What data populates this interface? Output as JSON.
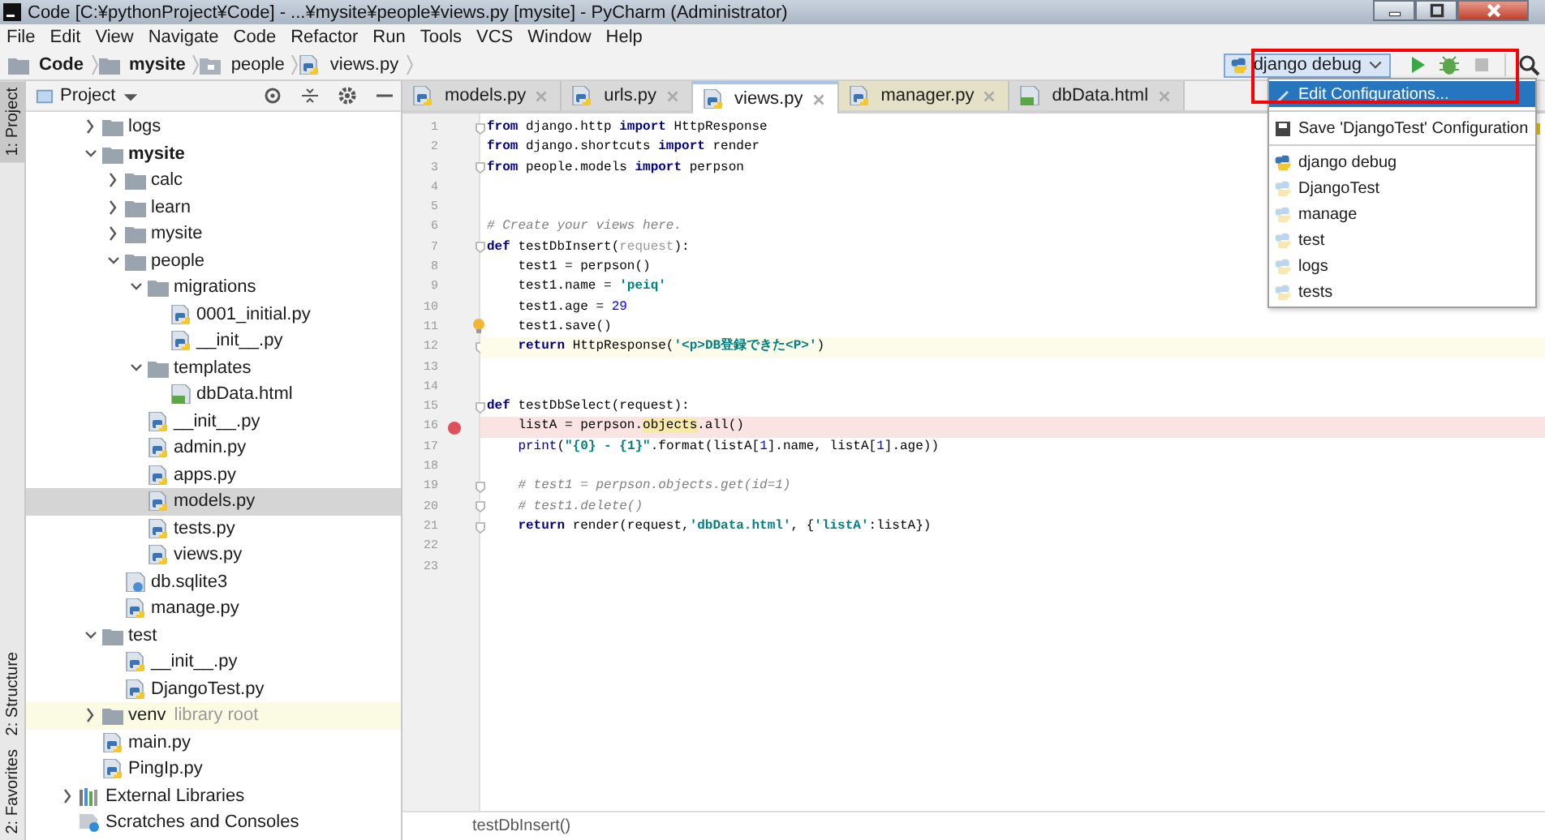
{
  "window": {
    "title": "Code [C:¥pythonProject¥Code] - ...¥mysite¥people¥views.py [mysite] - PyCharm (Administrator)"
  },
  "menu": [
    "File",
    "Edit",
    "View",
    "Navigate",
    "Code",
    "Refactor",
    "Run",
    "Tools",
    "VCS",
    "Window",
    "Help"
  ],
  "breadcrumbs": [
    {
      "label": "Code",
      "kind": "folder",
      "bold": true
    },
    {
      "label": "mysite",
      "kind": "folder",
      "bold": true
    },
    {
      "label": "people",
      "kind": "package",
      "bold": false
    },
    {
      "label": "views.py",
      "kind": "python",
      "bold": false
    }
  ],
  "run_config": {
    "label": "django debug"
  },
  "annotation_frame": true,
  "config_menu": {
    "items": [
      {
        "label": "Edit Configurations...",
        "kind": "edit",
        "selected": true,
        "temporary": false
      },
      {
        "label": "Save 'DjangoTest' Configuration",
        "kind": "save",
        "selected": false,
        "temporary": false
      },
      {
        "label": "django debug",
        "kind": "config",
        "selected": false,
        "temporary": false
      },
      {
        "label": "DjangoTest",
        "kind": "config",
        "selected": false,
        "temporary": true
      },
      {
        "label": "manage",
        "kind": "config",
        "selected": false,
        "temporary": true
      },
      {
        "label": "test",
        "kind": "config",
        "selected": false,
        "temporary": true
      },
      {
        "label": "logs",
        "kind": "config",
        "selected": false,
        "temporary": true
      },
      {
        "label": "tests",
        "kind": "config",
        "selected": false,
        "temporary": true
      }
    ]
  },
  "tool_stripe": [
    {
      "label": "1: Project",
      "selected": true
    },
    {
      "label": "2: Structure",
      "selected": false
    },
    {
      "label": "2: Favorites",
      "selected": false
    }
  ],
  "project_panel": {
    "title": "Project",
    "items": [
      {
        "label": "logs",
        "kind": "folder",
        "expanded": false,
        "selected": false,
        "bold": false
      },
      {
        "label": "mysite",
        "kind": "folder",
        "expanded": true,
        "selected": false,
        "bold": true,
        "children": [
          {
            "label": "calc",
            "kind": "folder",
            "expanded": false,
            "selected": false,
            "bold": false
          },
          {
            "label": "learn",
            "kind": "folder",
            "expanded": false,
            "selected": false,
            "bold": false
          },
          {
            "label": "mysite",
            "kind": "folder",
            "expanded": false,
            "selected": false,
            "bold": false
          },
          {
            "label": "people",
            "kind": "folder",
            "expanded": true,
            "selected": false,
            "bold": false,
            "children": [
              {
                "label": "migrations",
                "kind": "folder",
                "expanded": true,
                "selected": false,
                "bold": false,
                "children": [
                  {
                    "label": "0001_initial.py",
                    "kind": "python",
                    "selected": false,
                    "bold": false
                  },
                  {
                    "label": "__init__.py",
                    "kind": "python",
                    "selected": false,
                    "bold": false
                  }
                ]
              },
              {
                "label": "templates",
                "kind": "folder",
                "expanded": true,
                "selected": false,
                "bold": false,
                "children": [
                  {
                    "label": "dbData.html",
                    "kind": "html",
                    "selected": false,
                    "bold": false
                  }
                ]
              },
              {
                "label": "__init__.py",
                "kind": "python",
                "selected": false,
                "bold": false
              },
              {
                "label": "admin.py",
                "kind": "python",
                "selected": false,
                "bold": false
              },
              {
                "label": "apps.py",
                "kind": "python",
                "selected": false,
                "bold": false
              },
              {
                "label": "models.py",
                "kind": "python",
                "selected": true,
                "bold": false
              },
              {
                "label": "tests.py",
                "kind": "python",
                "selected": false,
                "bold": false
              },
              {
                "label": "views.py",
                "kind": "python",
                "selected": false,
                "bold": false
              }
            ]
          },
          {
            "label": "db.sqlite3",
            "kind": "database",
            "selected": false,
            "bold": false
          },
          {
            "label": "manage.py",
            "kind": "python",
            "selected": false,
            "bold": false
          }
        ]
      },
      {
        "label": "test",
        "kind": "folder",
        "expanded": true,
        "selected": false,
        "bold": false,
        "children": [
          {
            "label": "__init__.py",
            "kind": "python",
            "selected": false,
            "bold": false
          },
          {
            "label": "DjangoTest.py",
            "kind": "python",
            "selected": false,
            "bold": false
          }
        ]
      },
      {
        "label": "venv",
        "kind": "folder",
        "expanded": false,
        "selected": false,
        "bold": false,
        "note": "library root"
      },
      {
        "label": "main.py",
        "kind": "python",
        "selected": false,
        "bold": false
      },
      {
        "label": "PingIp.py",
        "kind": "python",
        "selected": false,
        "bold": false
      }
    ],
    "extra_items": [
      {
        "label": "External Libraries",
        "kind": "libraries",
        "expanded": false,
        "selected": false,
        "bold": false
      },
      {
        "label": "Scratches and Consoles",
        "kind": "scratches",
        "selected": false,
        "bold": false
      }
    ]
  },
  "editor_tabs": [
    {
      "label": "models.py",
      "kind": "python",
      "selected": false,
      "color": "#d9d9d9"
    },
    {
      "label": "urls.py",
      "kind": "python",
      "selected": false,
      "color": "#d9d9d9"
    },
    {
      "label": "views.py",
      "kind": "python",
      "selected": true,
      "color": "#ffffff"
    },
    {
      "label": "manager.py",
      "kind": "python",
      "selected": false,
      "color": "#e4e1c6"
    },
    {
      "label": "dbData.html",
      "kind": "html",
      "selected": false,
      "color": "#d9d9d9"
    }
  ],
  "code": {
    "lines": [
      {
        "number": "1",
        "caret": false,
        "breakpoint": false,
        "fold": true,
        "bulb": false,
        "segments": [
          {
            "text": "from",
            "kind": "keyword"
          },
          {
            "text": " django.http ",
            "kind": "plain"
          },
          {
            "text": "import",
            "kind": "keyword"
          },
          {
            "text": " HttpResponse",
            "kind": "plain"
          }
        ]
      },
      {
        "number": "2",
        "caret": false,
        "breakpoint": false,
        "fold": false,
        "bulb": false,
        "segments": [
          {
            "text": "from",
            "kind": "keyword"
          },
          {
            "text": " django.shortcuts ",
            "kind": "plain"
          },
          {
            "text": "import",
            "kind": "keyword"
          },
          {
            "text": " render",
            "kind": "plain"
          }
        ]
      },
      {
        "number": "3",
        "caret": false,
        "breakpoint": false,
        "fold": true,
        "bulb": false,
        "segments": [
          {
            "text": "from",
            "kind": "keyword"
          },
          {
            "text": " people.models ",
            "kind": "plain"
          },
          {
            "text": "import",
            "kind": "keyword"
          },
          {
            "text": " perpson",
            "kind": "plain"
          }
        ]
      },
      {
        "number": "4",
        "caret": false,
        "breakpoint": false,
        "fold": false,
        "bulb": false
      },
      {
        "number": "5",
        "caret": false,
        "breakpoint": false,
        "fold": false,
        "bulb": false
      },
      {
        "number": "6",
        "caret": false,
        "breakpoint": false,
        "fold": false,
        "bulb": false,
        "segments": [
          {
            "text": "# Create your views here.",
            "kind": "comment"
          }
        ]
      },
      {
        "number": "7",
        "caret": false,
        "breakpoint": false,
        "fold": true,
        "bulb": false,
        "segments": [
          {
            "text": "def",
            "kind": "keyword"
          },
          {
            "text": " testDbInsert(",
            "kind": "plain"
          },
          {
            "text": "request",
            "kind": "unused"
          },
          {
            "text": "):",
            "kind": "plain"
          }
        ]
      },
      {
        "number": "8",
        "caret": false,
        "breakpoint": false,
        "fold": false,
        "bulb": false,
        "segments": [
          {
            "text": "    test1 = perpson()",
            "kind": "plain"
          }
        ]
      },
      {
        "number": "9",
        "caret": false,
        "breakpoint": false,
        "fold": false,
        "bulb": false,
        "segments": [
          {
            "text": "    test1.name = ",
            "kind": "plain"
          },
          {
            "text": "'peiq'",
            "kind": "string"
          }
        ]
      },
      {
        "number": "10",
        "caret": false,
        "breakpoint": false,
        "fold": false,
        "bulb": false,
        "segments": [
          {
            "text": "    test1.age = ",
            "kind": "plain"
          },
          {
            "text": "29",
            "kind": "number"
          }
        ]
      },
      {
        "number": "11",
        "caret": false,
        "breakpoint": false,
        "fold": false,
        "bulb": true,
        "segments": [
          {
            "text": "    test1.save()",
            "kind": "plain"
          }
        ]
      },
      {
        "number": "12",
        "caret": true,
        "breakpoint": false,
        "fold": true,
        "bulb": false,
        "segments": [
          {
            "text": "    return",
            "kind": "keyword"
          },
          {
            "text": " HttpResponse(",
            "kind": "plain"
          },
          {
            "text": "'<p>DB登録できた<P>'",
            "kind": "string"
          },
          {
            "text": ")",
            "kind": "plain"
          }
        ]
      },
      {
        "number": "13",
        "caret": false,
        "breakpoint": false,
        "fold": false,
        "bulb": false
      },
      {
        "number": "14",
        "caret": false,
        "breakpoint": false,
        "fold": false,
        "bulb": false
      },
      {
        "number": "15",
        "caret": false,
        "breakpoint": false,
        "fold": true,
        "bulb": false,
        "segments": [
          {
            "text": "def",
            "kind": "keyword"
          },
          {
            "text": " testDbSelect(request):",
            "kind": "plain"
          }
        ]
      },
      {
        "number": "16",
        "caret": false,
        "breakpoint": true,
        "fold": false,
        "bulb": false,
        "segments": [
          {
            "text": "    listA = perpson.",
            "kind": "plain"
          },
          {
            "text": "objects",
            "kind": "highlight"
          },
          {
            "text": ".all()",
            "kind": "plain"
          }
        ]
      },
      {
        "number": "17",
        "caret": false,
        "breakpoint": false,
        "fold": false,
        "bulb": false,
        "segments": [
          {
            "text": "    print",
            "kind": "builtin"
          },
          {
            "text": "(",
            "kind": "plain"
          },
          {
            "text": "\"{0} - {1}\"",
            "kind": "string"
          },
          {
            "text": ".format(listA[",
            "kind": "plain"
          },
          {
            "text": "1",
            "kind": "number"
          },
          {
            "text": "].name, listA[",
            "kind": "plain"
          },
          {
            "text": "1",
            "kind": "number"
          },
          {
            "text": "].age))",
            "kind": "plain"
          }
        ]
      },
      {
        "number": "18",
        "caret": false,
        "breakpoint": false,
        "fold": false,
        "bulb": false
      },
      {
        "number": "19",
        "caret": false,
        "breakpoint": false,
        "fold": true,
        "bulb": false,
        "segments": [
          {
            "text": "    # test1 = perpson.objects.get(id=1)",
            "kind": "comment"
          }
        ]
      },
      {
        "number": "20",
        "caret": false,
        "breakpoint": false,
        "fold": true,
        "bulb": false,
        "segments": [
          {
            "text": "    # test1.delete()",
            "kind": "comment"
          }
        ]
      },
      {
        "number": "21",
        "caret": false,
        "breakpoint": false,
        "fold": true,
        "bulb": false,
        "segments": [
          {
            "text": "    return",
            "kind": "keyword"
          },
          {
            "text": " render(request,",
            "kind": "plain"
          },
          {
            "text": "'dbData.html'",
            "kind": "string"
          },
          {
            "text": ", {",
            "kind": "plain"
          },
          {
            "text": "'listA'",
            "kind": "string"
          },
          {
            "text": ":listA})",
            "kind": "plain"
          }
        ]
      },
      {
        "number": "22",
        "caret": false,
        "breakpoint": false,
        "fold": false,
        "bulb": false
      },
      {
        "number": "23",
        "caret": false,
        "breakpoint": false,
        "fold": false,
        "bulb": false
      }
    ]
  },
  "editor_breadcrumb": "testDbInsert()"
}
